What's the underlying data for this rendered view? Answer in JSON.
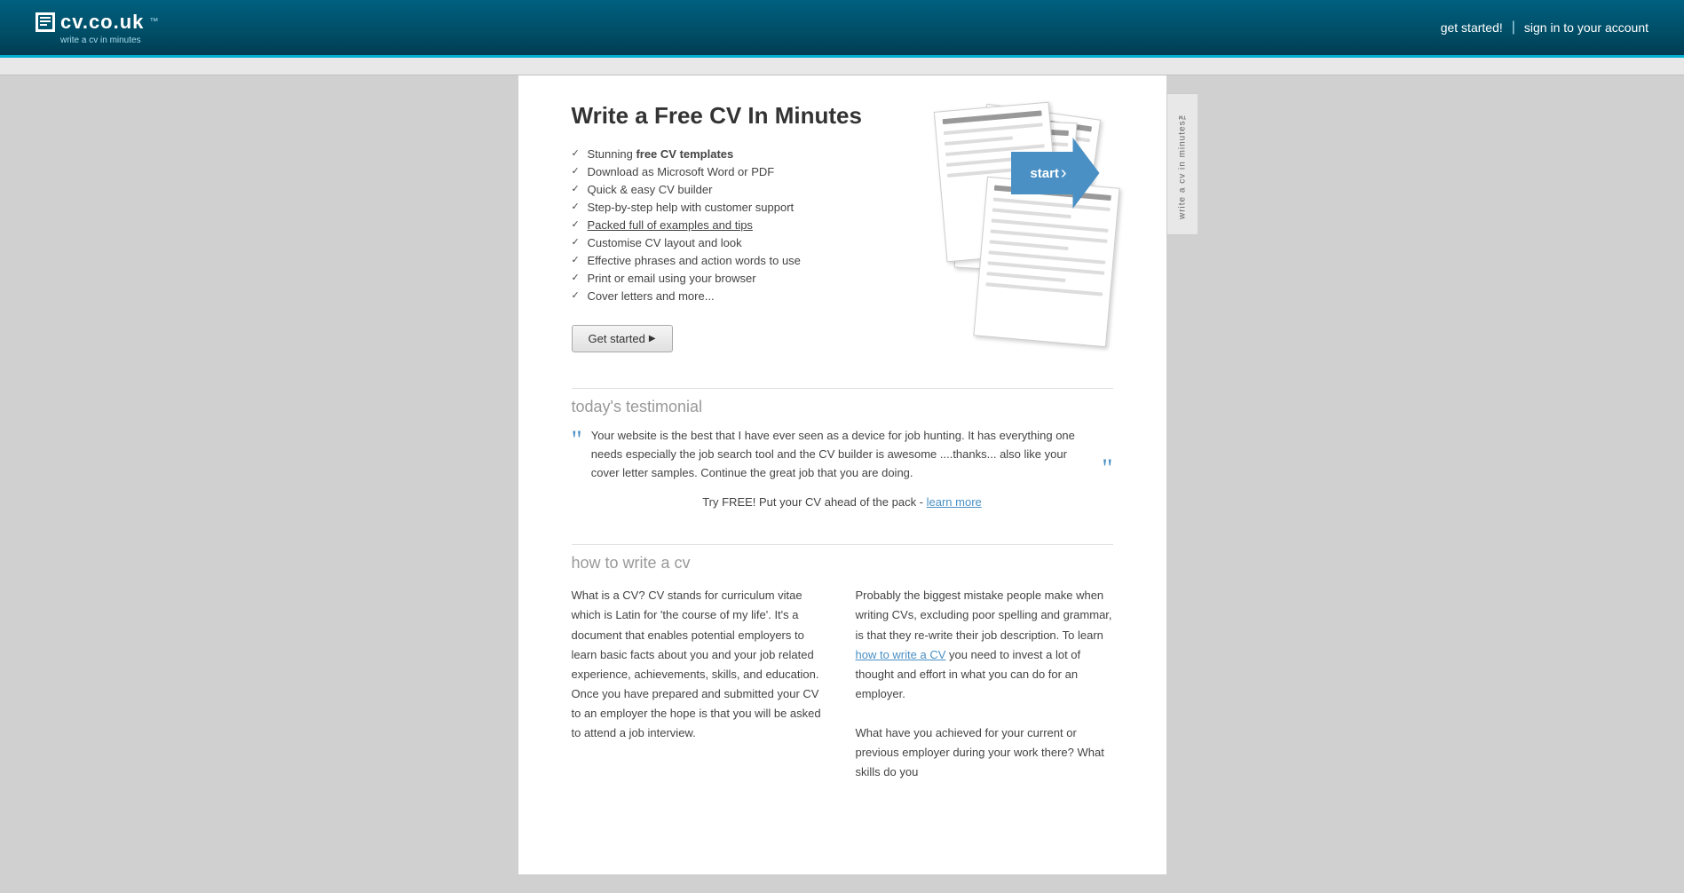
{
  "header": {
    "logo_text": "cv.co.uk",
    "logo_tm": "™",
    "logo_tagline": "write a cv in minutes",
    "nav_get_started": "get started!",
    "nav_divider": "|",
    "nav_sign_in": "sign in to your account"
  },
  "side_tab": {
    "text": "write a cv in minutes™"
  },
  "hero": {
    "title": "Write a Free CV In Minutes",
    "features": [
      {
        "text": "Stunning ",
        "bold": "free CV templates"
      },
      {
        "text": "Download as Microsoft Word or PDF",
        "bold": ""
      },
      {
        "text": "Quick & easy CV builder",
        "bold": ""
      },
      {
        "text": "Step-by-step help with customer support",
        "bold": ""
      },
      {
        "text": "Packed full of examples and tips",
        "bold": ""
      },
      {
        "text": "Customise CV layout and look",
        "bold": ""
      },
      {
        "text": "Effective phrases and action words to use",
        "bold": ""
      },
      {
        "text": "Print or email using your browser",
        "bold": ""
      },
      {
        "text": "Cover letters and more...",
        "bold": ""
      }
    ],
    "get_started_btn": "Get started",
    "start_arrow_label": "start"
  },
  "testimonial": {
    "title": "today's testimonial",
    "quote": "Your website is the best that I have ever seen as a device for job hunting. It has everything one needs especially the job search tool and the CV builder is awesome ....thanks... also like your cover letter samples. Continue the great job that you are doing.",
    "try_free_text": "Try FREE! Put your CV ahead of the pack - ",
    "learn_more": "learn more"
  },
  "howto": {
    "title": "how to write a cv",
    "col1": "What is a CV? CV stands for curriculum vitae which is Latin for 'the course of my life'. It's a document that enables potential employers to learn basic facts about you and your job related experience, achievements, skills, and education. Once you have prepared and submitted your CV to an employer the hope is that you will be asked to attend a job interview.",
    "col2_part1": "Probably the biggest mistake people make when writing CVs, excluding poor spelling and grammar, is that they re-write their job description. To learn ",
    "how_to_write_link": "how to write a CV",
    "col2_part2": " you need to invest a lot of thought and effort in what you can do for an employer.\n\nWhat have you achieved for your current or previous employer during your work there? What skills do you"
  },
  "colors": {
    "header_bg": "#005570",
    "accent_blue": "#4a90c4",
    "text_dark": "#333333",
    "text_mid": "#444444",
    "text_light": "#999999"
  }
}
